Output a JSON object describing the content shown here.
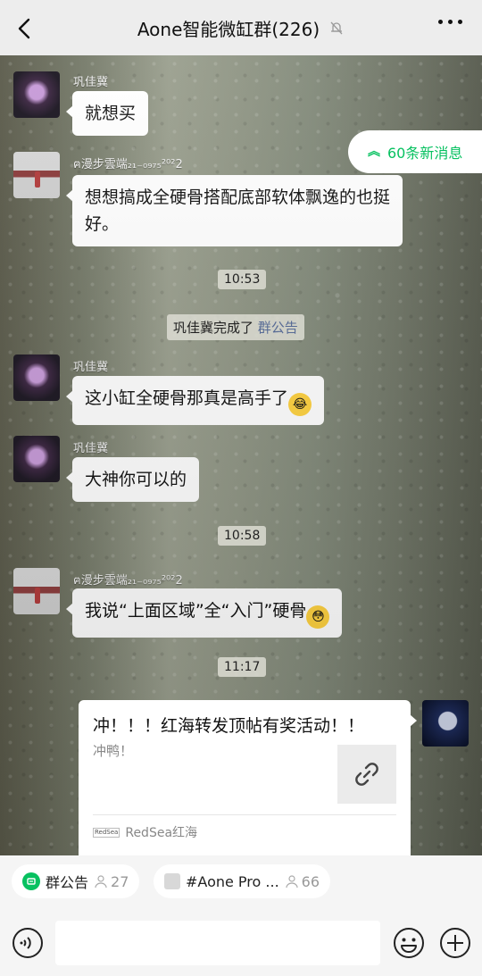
{
  "header": {
    "title": "Aone智能微缸群(226)"
  },
  "new_messages": "60条新消息",
  "messages": [
    {
      "sender": "巩佳冀",
      "text": "就想买"
    },
    {
      "sender": "ฅ漫步雲端₂₁₋₀₉₇₅²⁰²2",
      "text": "想想搞成全硬骨搭配底部软体飘逸的也挺好。"
    },
    {
      "sender": "巩佳冀",
      "text": "这小缸全硬骨那真是高手了"
    },
    {
      "sender": "巩佳冀",
      "text": "大神你可以的"
    },
    {
      "sender": "ฅ漫步雲端₂₁₋₀₉₇₅²⁰²2",
      "text": "我说“上面区域”全“入门”硬骨"
    }
  ],
  "times": [
    "10:53",
    "10:58",
    "11:17"
  ],
  "system": {
    "prefix": "巩佳冀完成了",
    "link": "群公告"
  },
  "card": {
    "title": "冲！！！红海转发顶帖有奖活动！！",
    "desc": "冲鸭！",
    "source_logo": "RedSea",
    "source": "RedSea红海"
  },
  "tags": [
    {
      "label": "群公告",
      "count": "27"
    },
    {
      "label": "#Aone Pro ...",
      "count": "66"
    }
  ],
  "icons": {
    "back": "chevron-left-icon",
    "mute": "bell-off-icon",
    "more": "more-dots-icon",
    "voice": "voice-icon",
    "emoji": "emoji-icon",
    "plus": "plus-circle-icon",
    "link": "link-icon"
  },
  "colors": {
    "accent_green": "#07c160",
    "link_blue": "#576b95"
  }
}
